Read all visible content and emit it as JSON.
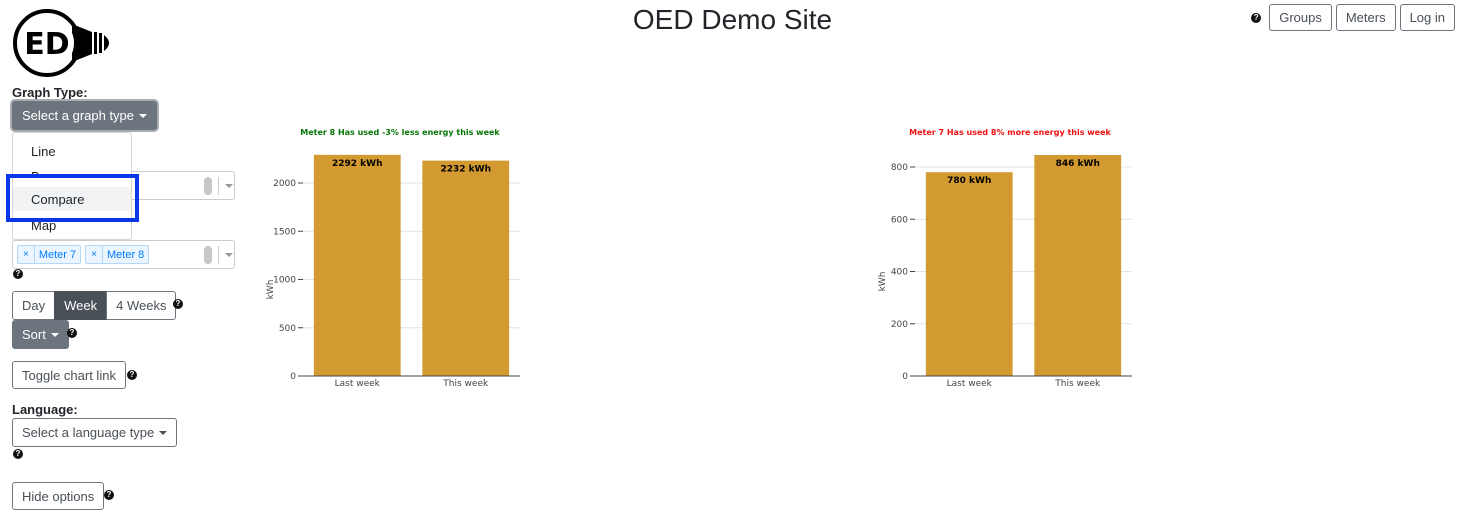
{
  "header": {
    "title": "OED Demo Site",
    "logo_text": "ED",
    "nav": [
      {
        "label": "Groups"
      },
      {
        "label": "Meters"
      },
      {
        "label": "Log in"
      }
    ]
  },
  "sidebar": {
    "graph_type_label": "Graph Type:",
    "graph_type_button": "Select a graph type",
    "graph_type_options": [
      {
        "label": "Line"
      },
      {
        "label": "Bar"
      },
      {
        "label": "Compare"
      },
      {
        "label": "Map"
      }
    ],
    "highlighted_option": "Compare",
    "selected_meters": [
      {
        "label": "Meter 7",
        "remove": "×"
      },
      {
        "label": "Meter 8",
        "remove": "×"
      }
    ],
    "time_intervals": [
      {
        "label": "Day",
        "active": false
      },
      {
        "label": "Week",
        "active": true
      },
      {
        "label": "4 Weeks",
        "active": false
      }
    ],
    "sort_label": "Sort",
    "toggle_chart_link_label": "Toggle chart link",
    "language_label": "Language:",
    "language_button": "Select a language type",
    "hide_options_label": "Hide options",
    "help_glyph": "?"
  },
  "colors": {
    "bar": "#d29a31",
    "increase": "#ee1111",
    "decrease": "#067606",
    "highlight": "#0a37e6"
  },
  "chart_data": [
    {
      "type": "bar",
      "title": "Meter 8 Has used -3% less energy this week",
      "title_color": "#067606",
      "categories": [
        "Last week",
        "This week"
      ],
      "values": [
        2292,
        2232
      ],
      "data_labels": [
        "2292 kWh",
        "2232 kWh"
      ],
      "xlabel": "",
      "ylabel": "kWh",
      "ylim": [
        0,
        2400
      ],
      "yticks": [
        0,
        500,
        1000,
        1500,
        2000
      ],
      "grid": true
    },
    {
      "type": "bar",
      "title": "Meter 7 Has used 8% more energy this week",
      "title_color": "#ee1111",
      "categories": [
        "Last week",
        "This week"
      ],
      "values": [
        780,
        846
      ],
      "data_labels": [
        "780 kWh",
        "846 kWh"
      ],
      "xlabel": "",
      "ylabel": "kWh",
      "ylim": [
        0,
        880
      ],
      "yticks": [
        0,
        200,
        400,
        600,
        800
      ],
      "grid": true
    }
  ]
}
